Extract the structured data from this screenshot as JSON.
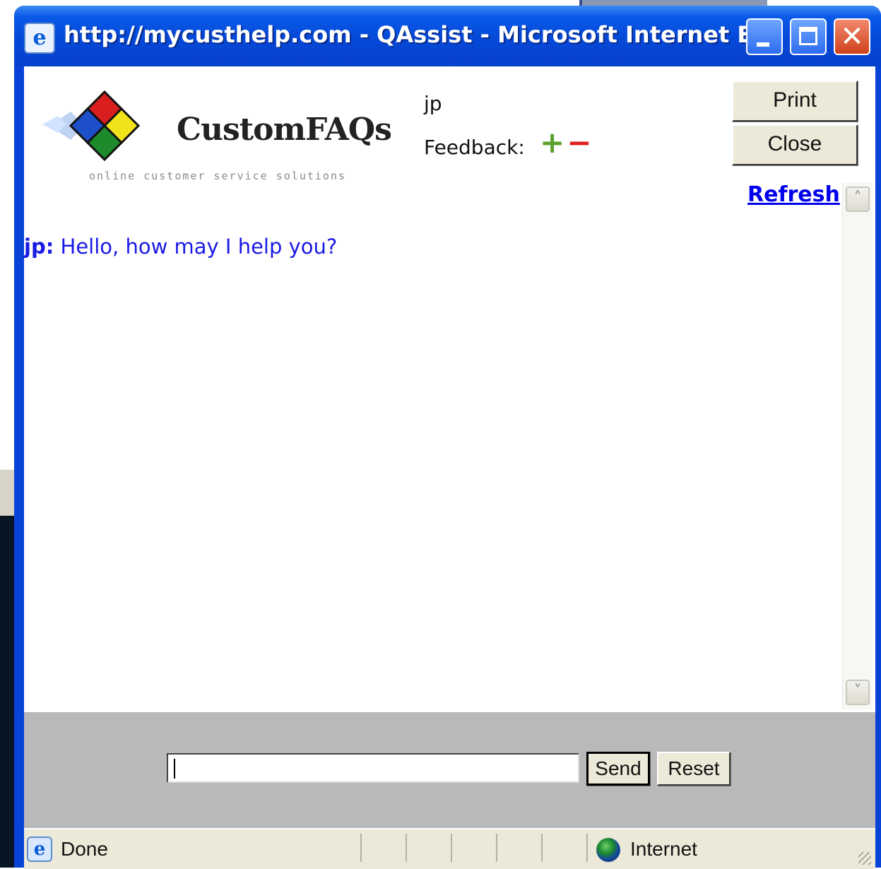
{
  "window": {
    "title": "http://mycusthelp.com - QAssist - Microsoft Internet Ex...",
    "icon": "ie-page-icon",
    "controls": [
      "minimize-icon",
      "maximize-icon",
      "close-icon"
    ],
    "close_glyph": "✕"
  },
  "header": {
    "logo_name": "CustomFAQs",
    "logo_tagline": "online customer service solutions",
    "agent_name": "jp",
    "feedback_label": "Feedback:",
    "feedback_plus": "+",
    "feedback_minus": "−",
    "print_label": "Print",
    "close_label": "Close",
    "refresh_label": "Refresh"
  },
  "chat": {
    "messages": [
      {
        "sender": "jp:",
        "text": "Hello, how may I help you?"
      }
    ]
  },
  "input": {
    "value": "",
    "send_label": "Send",
    "reset_label": "Reset"
  },
  "statusbar": {
    "status_text": "Done",
    "zone_text": "Internet"
  },
  "colors": {
    "titlebar": "#0548d8",
    "chat_text": "#1a1ae6",
    "link": "#0000ee",
    "feedback_plus": "#5aa02c",
    "feedback_minus": "#e02020",
    "input_panel": "#b9b9b9",
    "button_face": "#ece9d8"
  }
}
